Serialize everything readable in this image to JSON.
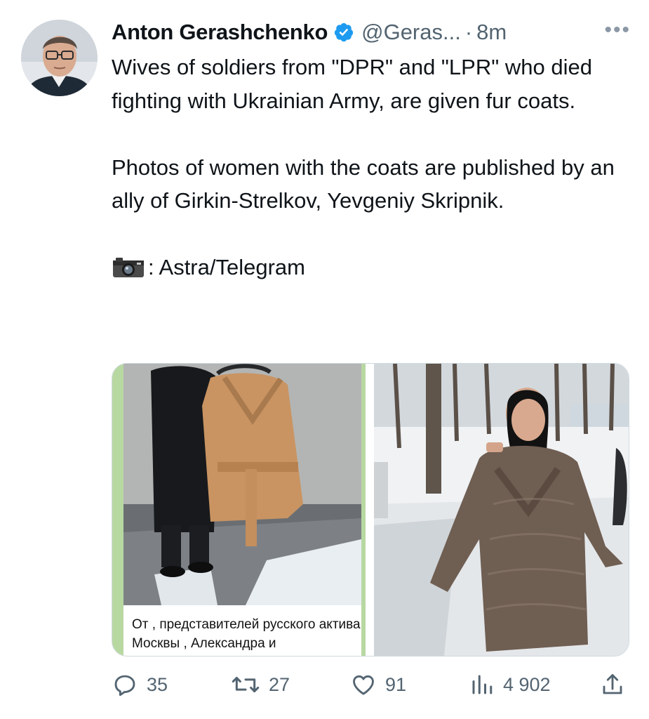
{
  "tweet": {
    "author_name": "Anton Gerashchenko",
    "handle": "@Geras...",
    "separator": "·",
    "time": "8m",
    "more": "•••",
    "text_lines": {
      "p1": "Wives of soldiers from \"DPR\" and \"LPR\" who died fighting with Ukrainian Army, are given fur coats.",
      "p2": "Photos of women with the coats are published by an ally of Girkin-Strelkov, Yevgeniy Skripnik.",
      "p3": ": Astra/Telegram"
    }
  },
  "media": {
    "left_caption": "От , представителей  русского актива Москвы , Александра и"
  },
  "metrics": {
    "replies": "35",
    "retweets": "27",
    "likes": "91",
    "views": "4 902"
  },
  "colors": {
    "verified": "#1d9bf0",
    "muted": "#536471"
  },
  "icons": [
    "avatar",
    "verified-badge-icon",
    "more-icon",
    "camera-emoji-icon",
    "reply-icon",
    "retweet-icon",
    "like-icon",
    "views-icon",
    "share-icon"
  ]
}
